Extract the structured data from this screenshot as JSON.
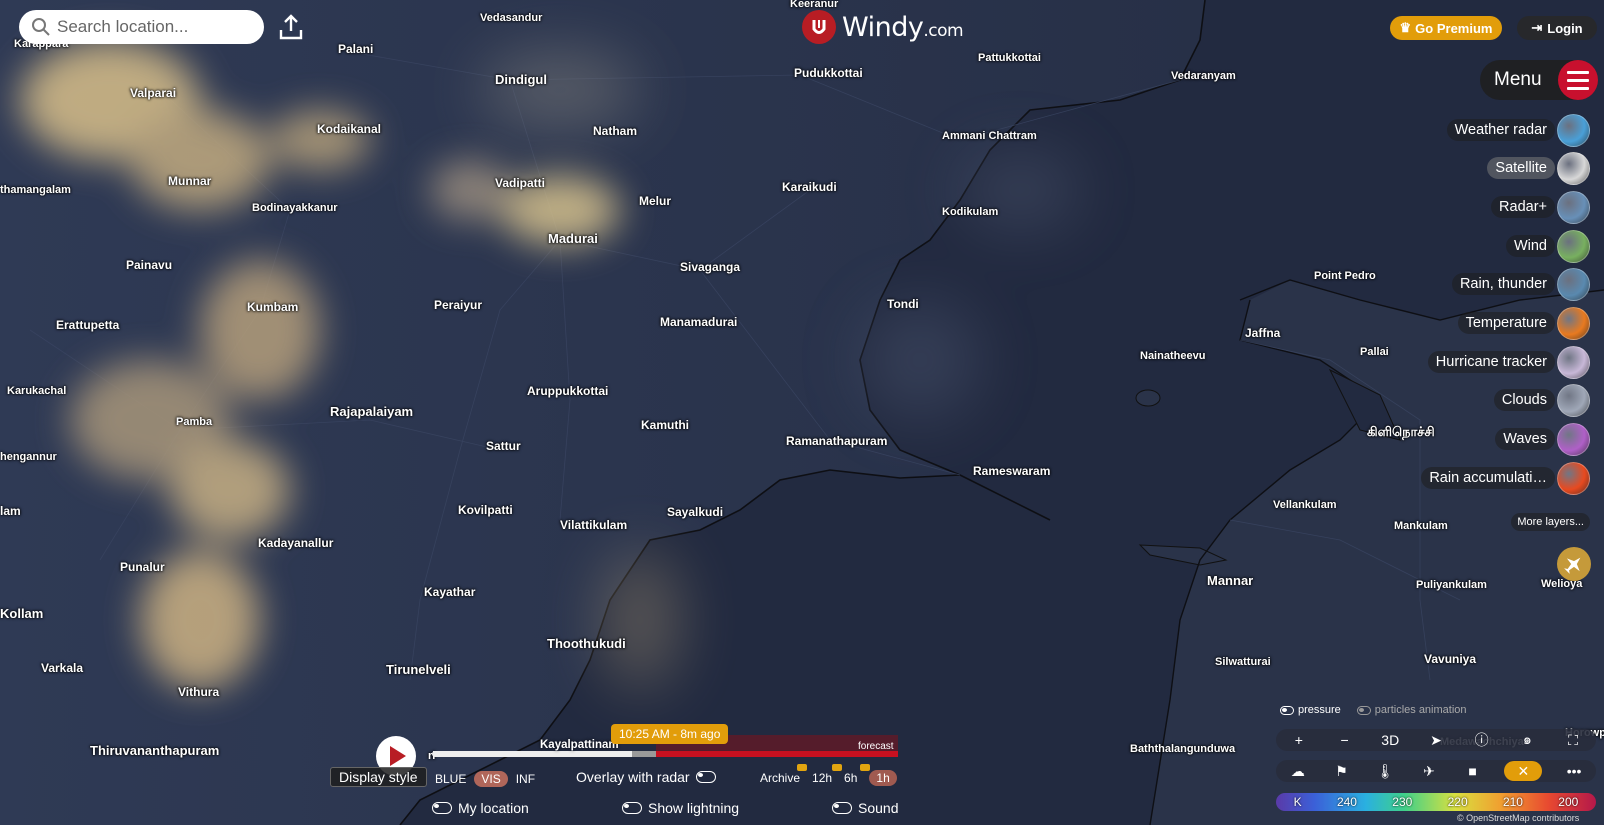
{
  "header": {
    "search_placeholder": "Search location...",
    "logo_main": "Windy",
    "logo_suffix": ".com",
    "premium_label": "Go Premium",
    "login_label": "Login"
  },
  "menu": {
    "label": "Menu",
    "layers": [
      {
        "label": "Weather radar",
        "active": false,
        "color": "#4aa0d8"
      },
      {
        "label": "Satellite",
        "active": true,
        "color": "#d8d8d8"
      },
      {
        "label": "Radar+",
        "active": false,
        "color": "#6890b8"
      },
      {
        "label": "Wind",
        "active": false,
        "color": "#78b060"
      },
      {
        "label": "Rain, thunder",
        "active": false,
        "color": "#5a8ab0"
      },
      {
        "label": "Temperature",
        "active": false,
        "color": "#e87a20"
      },
      {
        "label": "Hurricane tracker",
        "active": false,
        "color": "#c8b8d8"
      },
      {
        "label": "Clouds",
        "active": false,
        "color": "#a0a8b8"
      },
      {
        "label": "Waves",
        "active": false,
        "color": "#b060c8"
      },
      {
        "label": "Rain accumulati…",
        "active": false,
        "color": "#e84a20"
      }
    ],
    "more_layers": "More layers..."
  },
  "map_labels": [
    {
      "name": "Keeranur",
      "cls": "small"
    },
    {
      "name": "Vedasandur",
      "cls": "small"
    },
    {
      "name": "Karappara",
      "cls": "small"
    },
    {
      "name": "Palani",
      "cls": ""
    },
    {
      "name": "Dindigul",
      "cls": "big"
    },
    {
      "name": "Pudukkottai",
      "cls": ""
    },
    {
      "name": "Pattukkottai",
      "cls": "small"
    },
    {
      "name": "Vedaranyam",
      "cls": "small"
    },
    {
      "name": "Valparai",
      "cls": ""
    },
    {
      "name": "Kodaikanal",
      "cls": ""
    },
    {
      "name": "Natham",
      "cls": ""
    },
    {
      "name": "Ammani Chattram",
      "cls": "small"
    },
    {
      "name": "thamangalam",
      "cls": "small"
    },
    {
      "name": "Munnar",
      "cls": ""
    },
    {
      "name": "Vadipatti",
      "cls": ""
    },
    {
      "name": "Melur",
      "cls": ""
    },
    {
      "name": "Karaikudi",
      "cls": ""
    },
    {
      "name": "Bodinayakkanur",
      "cls": "small"
    },
    {
      "name": "Kodikulam",
      "cls": "small"
    },
    {
      "name": "Madurai",
      "cls": "big"
    },
    {
      "name": "Painavu",
      "cls": ""
    },
    {
      "name": "Sivaganga",
      "cls": ""
    },
    {
      "name": "Point Pedro",
      "cls": "small"
    },
    {
      "name": "Kumbam",
      "cls": ""
    },
    {
      "name": "Peraiyur",
      "cls": ""
    },
    {
      "name": "Tondi",
      "cls": ""
    },
    {
      "name": "Erattupetta",
      "cls": ""
    },
    {
      "name": "Manamadurai",
      "cls": ""
    },
    {
      "name": "Jaffna",
      "cls": ""
    },
    {
      "name": "Pallai",
      "cls": "small"
    },
    {
      "name": "Nainatheevu",
      "cls": "small"
    },
    {
      "name": "Aruppukkottai",
      "cls": ""
    },
    {
      "name": "Karukachal",
      "cls": "small"
    },
    {
      "name": "Rajapalaiyam",
      "cls": "big"
    },
    {
      "name": "Pamba",
      "cls": "small"
    },
    {
      "name": "Kamuthi",
      "cls": ""
    },
    {
      "name": "கிளிநொச்சி",
      "cls": "big"
    },
    {
      "name": "Ramanathapuram",
      "cls": ""
    },
    {
      "name": "Sattur",
      "cls": ""
    },
    {
      "name": "hengannur",
      "cls": "small"
    },
    {
      "name": "Rameswaram",
      "cls": ""
    },
    {
      "name": "Vellankulam",
      "cls": "small"
    },
    {
      "name": "Kovilpatti",
      "cls": ""
    },
    {
      "name": "Sayalkudi",
      "cls": ""
    },
    {
      "name": "lam",
      "cls": ""
    },
    {
      "name": "Vilattikulam",
      "cls": ""
    },
    {
      "name": "Mankulam",
      "cls": "small"
    },
    {
      "name": "Kadayanallur",
      "cls": ""
    },
    {
      "name": "Punalur",
      "cls": ""
    },
    {
      "name": "Mannar",
      "cls": "big"
    },
    {
      "name": "Kayathar",
      "cls": ""
    },
    {
      "name": "Puliyankulam",
      "cls": "small"
    },
    {
      "name": "Welioya",
      "cls": "small"
    },
    {
      "name": "Kollam",
      "cls": "big"
    },
    {
      "name": "Thoothukudi",
      "cls": "big"
    },
    {
      "name": "Silwatturai",
      "cls": "small"
    },
    {
      "name": "Vavuniya",
      "cls": ""
    },
    {
      "name": "Varkala",
      "cls": ""
    },
    {
      "name": "Tirunelveli",
      "cls": "big"
    },
    {
      "name": "Vithura",
      "cls": ""
    },
    {
      "name": "Horowpotana",
      "cls": "small"
    },
    {
      "name": "Medawachchiya",
      "cls": "small"
    },
    {
      "name": "Thiruvananthapuram",
      "cls": "big"
    },
    {
      "name": "Baththalangunduwa",
      "cls": "small"
    },
    {
      "name": "ri",
      "cls": "small"
    }
  ],
  "timeline": {
    "time_label": "10:25 AM - 8m ago",
    "location_label": "Kayalpattinam",
    "forecast_label": "forecast",
    "display_style_label": "Display style",
    "style_options": [
      "BLUE",
      "VIS",
      "INF"
    ],
    "active_style": "VIS",
    "overlay_label": "Overlay with radar",
    "archive_label": "Archive",
    "intervals": [
      "12h",
      "6h",
      "1h"
    ],
    "active_interval": "1h",
    "my_location_label": "My location",
    "show_lightning_label": "Show lightning",
    "sound_label": "Sound"
  },
  "map_controls": {
    "pressure_label": "pressure",
    "particles_label": "particles animation",
    "zoom_in": "+",
    "zoom_out": "−",
    "view_3d": "3D",
    "legend_unit": "K",
    "legend_values": [
      "240",
      "230",
      "220",
      "210",
      "200"
    ],
    "attribution": "© OpenStreetMap contributors"
  },
  "colors": {
    "accent": "#e29d0a",
    "brand_red": "#c8102e",
    "map_bg": "#262f45"
  }
}
